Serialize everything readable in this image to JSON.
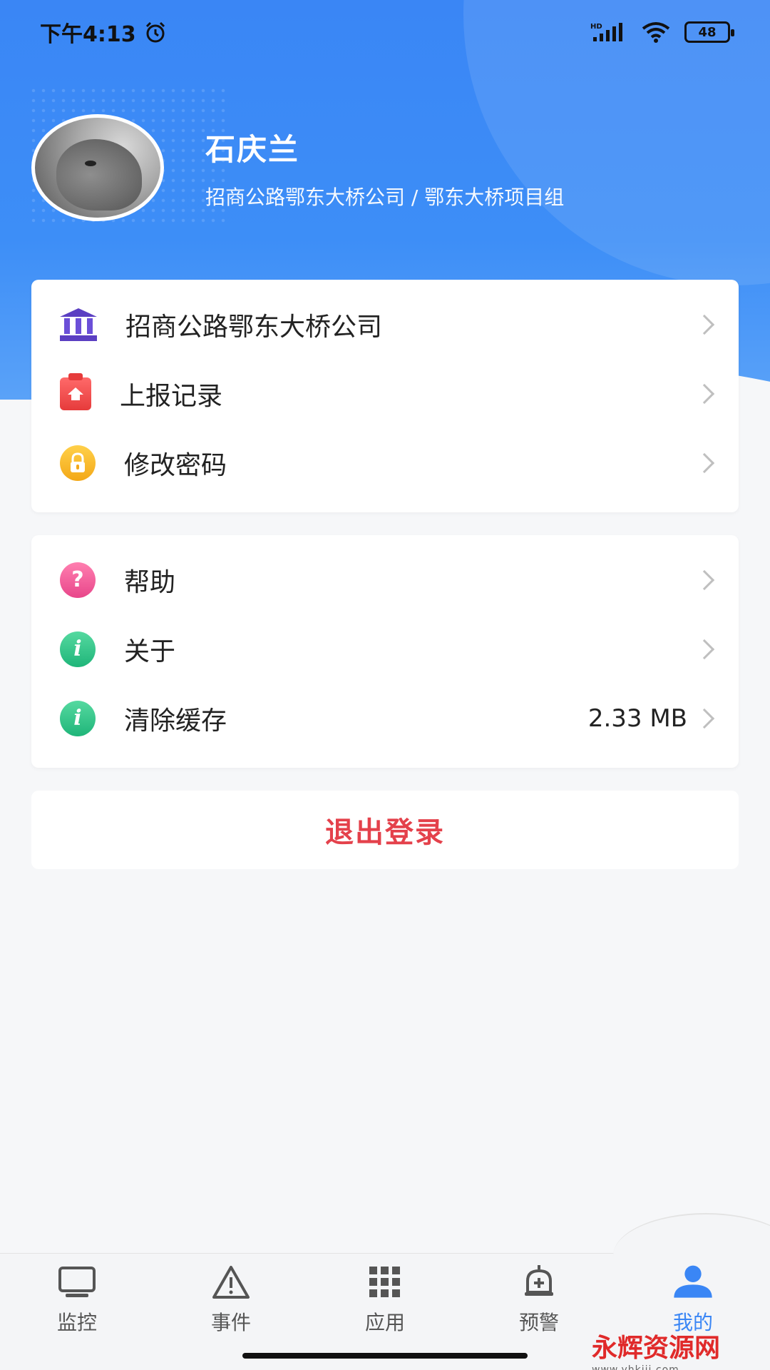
{
  "status_bar": {
    "time": "下午4:13",
    "network": "HD",
    "battery": "48"
  },
  "profile": {
    "name": "石庆兰",
    "subtitle": "招商公路鄂东大桥公司 / 鄂东大桥项目组"
  },
  "menu_group_1": [
    {
      "label": "招商公路鄂东大桥公司",
      "icon": "bank-icon"
    },
    {
      "label": "上报记录",
      "icon": "report-clipboard-icon"
    },
    {
      "label": "修改密码",
      "icon": "lock-icon"
    }
  ],
  "menu_group_2": [
    {
      "label": "帮助",
      "icon": "help-icon"
    },
    {
      "label": "关于",
      "icon": "info-icon"
    },
    {
      "label": "清除缓存",
      "icon": "info-icon",
      "value": "2.33 MB"
    }
  ],
  "logout_label": "退出登录",
  "bottom_nav": [
    {
      "label": "监控",
      "icon": "monitor-icon",
      "active": false
    },
    {
      "label": "事件",
      "icon": "warning-triangle-icon",
      "active": false
    },
    {
      "label": "应用",
      "icon": "apps-grid-icon",
      "active": false
    },
    {
      "label": "预警",
      "icon": "alarm-bell-icon",
      "active": false
    },
    {
      "label": "我的",
      "icon": "user-icon",
      "active": true
    }
  ],
  "watermark": {
    "text": "永辉资源网",
    "url_text": "www.yhkjjj.com"
  },
  "colors": {
    "header_blue": "#3a86f5",
    "logout_red": "#e4414b",
    "active_blue": "#3a86f5"
  }
}
